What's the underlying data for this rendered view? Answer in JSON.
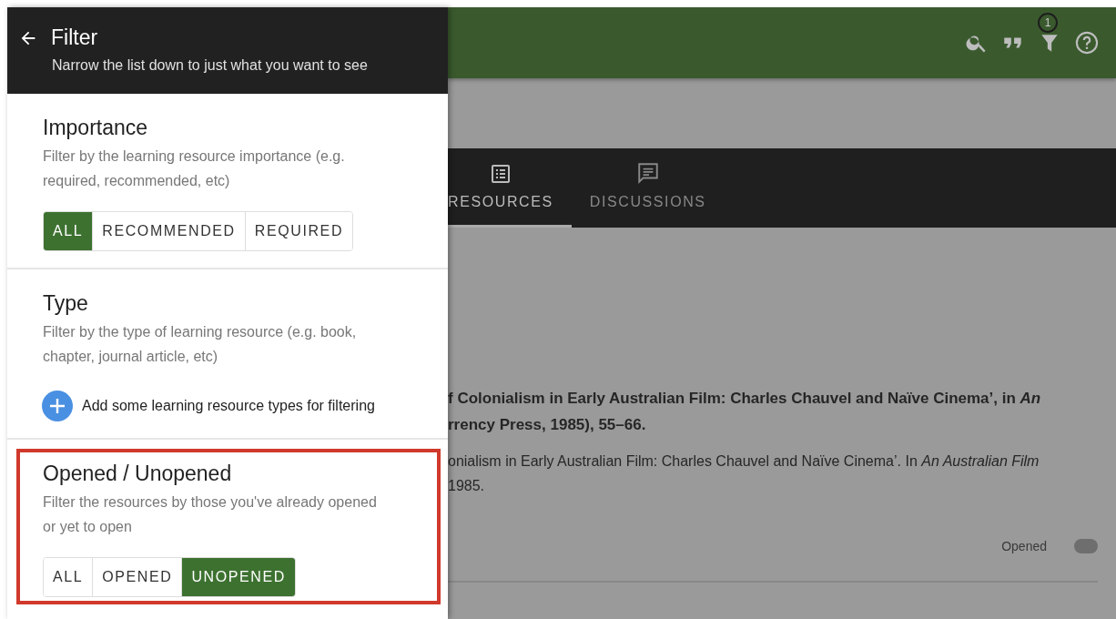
{
  "drawer": {
    "title": "Filter",
    "subtitle": "Narrow the list down to just what you want to see",
    "sections": [
      {
        "kind": "segmented",
        "title": "Importance",
        "description": "Filter by the learning resource importance (e.g. required, recommended, etc)",
        "highlighted": false,
        "options": [
          {
            "label": "ALL",
            "selected": true
          },
          {
            "label": "RECOMMENDED",
            "selected": false
          },
          {
            "label": "REQUIRED",
            "selected": false
          }
        ]
      },
      {
        "kind": "add",
        "title": "Type",
        "description": "Filter by the type of learning resource (e.g. book, chapter, journal article, etc)",
        "highlighted": false,
        "action": "Add some learning resource types for filtering"
      },
      {
        "kind": "segmented",
        "title": "Opened / Unopened",
        "description": "Filter the resources by those you've already opened or yet to open",
        "highlighted": true,
        "options": [
          {
            "label": "ALL",
            "selected": false
          },
          {
            "label": "OPENED",
            "selected": false
          },
          {
            "label": "UNOPENED",
            "selected": true
          }
        ]
      }
    ]
  },
  "app": {
    "toolbar": {
      "filter_badge": "1"
    },
    "tabs": [
      {
        "label": "RESOURCES",
        "selected": true
      },
      {
        "label": "DISCUSSIONS",
        "selected": false
      }
    ],
    "citation": {
      "primary": [
        "f Colonialism in Early Australian Film: Charles Chauvel and Naïve Cinema’, in *An*",
        "rrency Press, 1985), 55–66."
      ],
      "secondary": [
        "onialism in Early Australian Film: Charles Chauvel and Naïve Cinema’. In *An Australian Film*",
        "1985."
      ],
      "opened_label": "Opened",
      "opened_on": false
    }
  }
}
